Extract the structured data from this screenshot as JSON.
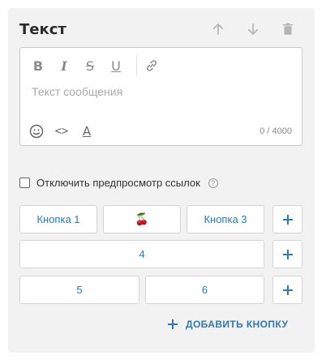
{
  "header": {
    "title": "Текст"
  },
  "editor": {
    "format": {
      "bold": "B",
      "italic": "I",
      "strike": "S",
      "underline": "U"
    },
    "placeholder": "Текст сообщения",
    "counter": "0 / 4000",
    "code_symbol": "<>",
    "font_symbol": "A"
  },
  "link_preview": {
    "label": "Отключить предпросмотр ссылок",
    "checked": false,
    "help": "?"
  },
  "buttons": {
    "row1": [
      "Кнопка 1",
      "🍒",
      "Кнопка 3"
    ],
    "row2": [
      "4"
    ],
    "row3": [
      "5",
      "6"
    ]
  },
  "add_button": {
    "label": "ДОБАВИТЬ КНОПКУ"
  },
  "colors": {
    "accent": "#2a7ab8",
    "card_bg": "#f2f2f2",
    "icon_gray": "#b5b5b5"
  }
}
